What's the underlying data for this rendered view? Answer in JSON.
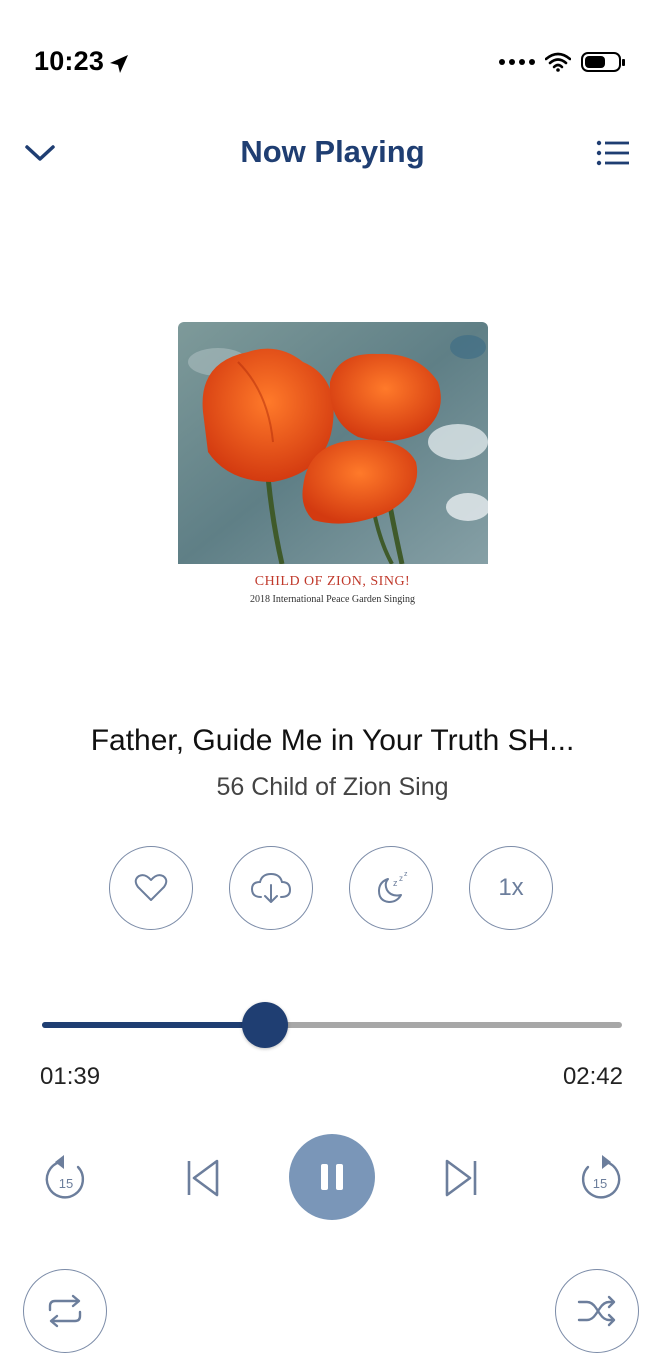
{
  "status_bar": {
    "time": "10:23",
    "icons": [
      "location-arrow-icon",
      "signal-dots-icon",
      "wifi-icon",
      "battery-icon"
    ]
  },
  "header": {
    "title": "Now Playing",
    "left_icon": "chevron-down-icon",
    "right_icon": "queue-list-icon"
  },
  "artwork": {
    "caption_title": "CHILD OF ZION, SING!",
    "caption_subtitle": "2018 International Peace Garden Singing"
  },
  "track": {
    "title": "Father, Guide Me in Your Truth SH...",
    "album": "56 Child of Zion Sing"
  },
  "actions": [
    {
      "icon": "heart-icon"
    },
    {
      "icon": "download-cloud-icon"
    },
    {
      "icon": "sleep-timer-icon"
    },
    {
      "icon": "playback-speed-icon",
      "label": "1x"
    }
  ],
  "progress": {
    "elapsed": "01:39",
    "total": "02:42",
    "fraction": 0.385
  },
  "controls": {
    "rewind_seconds": "15",
    "forward_seconds": "15",
    "state": "playing"
  },
  "colors": {
    "accent": "#1f3e72",
    "play_button": "#7a96b8",
    "outline": "#7c8ca8",
    "track_inactive": "#a7a7a7"
  }
}
